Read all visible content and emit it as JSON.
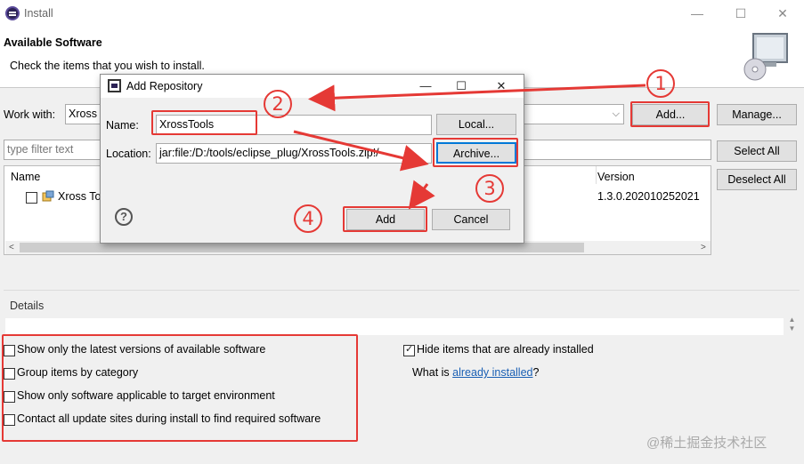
{
  "window": {
    "title": "Install",
    "minimize_glyph": "—",
    "maximize_glyph": "☐",
    "close_glyph": "✕"
  },
  "header": {
    "title": "Available Software",
    "description": "Check the items that you wish to install."
  },
  "work_with": {
    "label": "Work with:",
    "value": "Xross",
    "add_button": "Add...",
    "manage_button": "Manage..."
  },
  "filter": {
    "placeholder": "type filter text",
    "select_all_button": "Select All",
    "deselect_all_button": "Deselect All"
  },
  "table": {
    "columns": [
      "Name",
      "Version"
    ],
    "rows": [
      {
        "name": "Xross To",
        "version": "1.3.0.202010252021",
        "checked": false
      }
    ]
  },
  "details": {
    "title": "Details"
  },
  "options": {
    "left": [
      {
        "label": "Show only the latest versions of available software",
        "checked": false
      },
      {
        "label": "Group items by category",
        "checked": false
      },
      {
        "label": "Show only software applicable to target environment",
        "checked": false
      },
      {
        "label": "Contact all update sites during install to find required software",
        "checked": false
      }
    ],
    "hide_installed": {
      "label": "Hide items that are already installed",
      "checked": true
    },
    "what_is_prefix": "What is ",
    "what_is_link": "already installed",
    "what_is_suffix": "?"
  },
  "dialog": {
    "title": "Add Repository",
    "name_label": "Name:",
    "name_value": "XrossTools",
    "local_button": "Local...",
    "location_label": "Location:",
    "location_value": "jar:file:/D:/tools/eclipse_plug/XrossTools.zip!/",
    "archive_button": "Archive...",
    "help_glyph": "?",
    "add_button": "Add",
    "cancel_button": "Cancel"
  },
  "annotations": {
    "steps": [
      "1",
      "2",
      "3",
      "4"
    ],
    "color": "#e53935"
  },
  "watermark": "@稀土掘金技术社区"
}
